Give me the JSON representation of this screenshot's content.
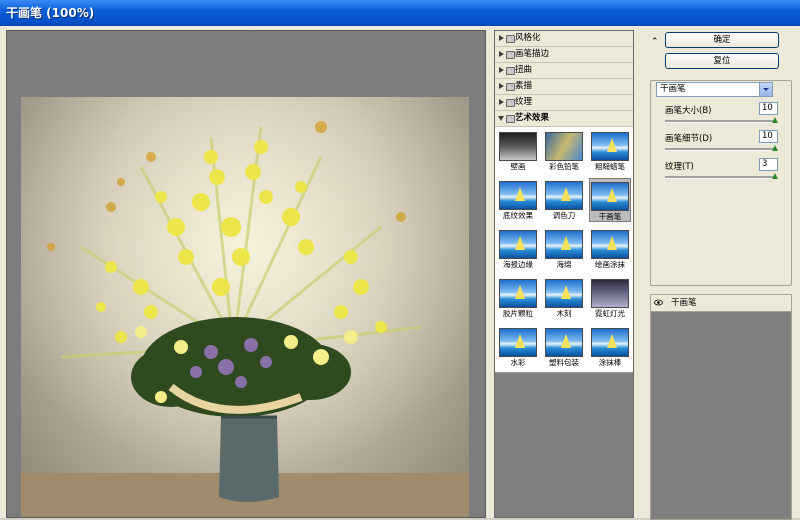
{
  "window": {
    "title": "干画笔 (100%)"
  },
  "categories": [
    {
      "label": "风格化",
      "expanded": false
    },
    {
      "label": "画笔描边",
      "expanded": false
    },
    {
      "label": "扭曲",
      "expanded": false
    },
    {
      "label": "素描",
      "expanded": false
    },
    {
      "label": "纹理",
      "expanded": false
    },
    {
      "label": "艺术效果",
      "expanded": true
    }
  ],
  "thumbnails": [
    {
      "label": "壁画"
    },
    {
      "label": "彩色铅笔"
    },
    {
      "label": "粗糙蜡笔"
    },
    {
      "label": "底纹效果"
    },
    {
      "label": "调色刀"
    },
    {
      "label": "干画笔",
      "selected": true
    },
    {
      "label": "海报边缘"
    },
    {
      "label": "海绵"
    },
    {
      "label": "绘画涂抹"
    },
    {
      "label": "胶片颗粒"
    },
    {
      "label": "木刻"
    },
    {
      "label": "霓虹灯光"
    },
    {
      "label": "水彩"
    },
    {
      "label": "塑料包装"
    },
    {
      "label": "涂抹棒"
    }
  ],
  "buttons": {
    "ok": "确定",
    "reset": "复位"
  },
  "filter_select": {
    "value": "干画笔"
  },
  "params": [
    {
      "label": "画笔大小(B)",
      "value": "10",
      "level": 1.0
    },
    {
      "label": "画笔细节(D)",
      "value": "10",
      "level": 1.0
    },
    {
      "label": "纹理(T)",
      "value": "3",
      "level": 1.0
    }
  ],
  "layer": {
    "name": "干画笔"
  },
  "colors": {
    "accent": "#0a5fd8",
    "preview_bg": "#7d7d7d",
    "gallery_bg": "#808080"
  }
}
